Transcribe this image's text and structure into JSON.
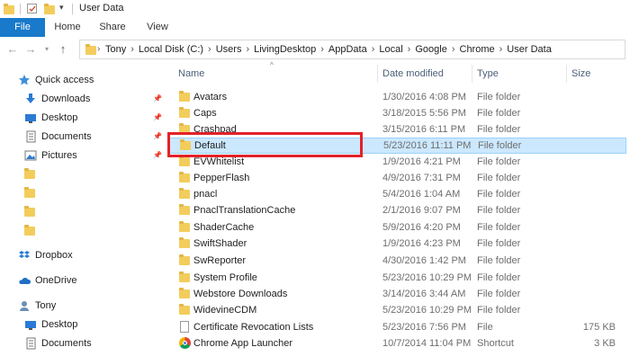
{
  "window": {
    "title": "User Data"
  },
  "ribbon": {
    "tabs": [
      {
        "label": "File"
      },
      {
        "label": "Home"
      },
      {
        "label": "Share"
      },
      {
        "label": "View"
      }
    ]
  },
  "address": {
    "crumbs": [
      "Tony",
      "Local Disk (C:)",
      "Users",
      "LivingDesktop",
      "AppData",
      "Local",
      "Google",
      "Chrome",
      "User Data"
    ]
  },
  "sidebar": {
    "items": [
      {
        "label": "Quick access",
        "icon": "star-icon"
      },
      {
        "label": "Downloads",
        "icon": "download-arrow-icon",
        "pinned": true
      },
      {
        "label": "Desktop",
        "icon": "desktop-icon",
        "pinned": true
      },
      {
        "label": "Documents",
        "icon": "documents-icon",
        "pinned": true
      },
      {
        "label": "Pictures",
        "icon": "pictures-icon",
        "pinned": true
      },
      {
        "label": "",
        "icon": "folder-icon"
      },
      {
        "label": "",
        "icon": "folder-icon"
      },
      {
        "label": "",
        "icon": "folder-icon"
      },
      {
        "label": "",
        "icon": "folder-icon"
      },
      {
        "label": "Dropbox",
        "icon": "dropbox-icon"
      },
      {
        "label": "OneDrive",
        "icon": "cloud-icon"
      },
      {
        "label": "Tony",
        "icon": "user-icon"
      },
      {
        "label": "Desktop",
        "icon": "desktop-icon"
      },
      {
        "label": "Documents",
        "icon": "documents-icon"
      }
    ]
  },
  "columns": {
    "name": "Name",
    "date": "Date modified",
    "type": "Type",
    "size": "Size"
  },
  "files": [
    {
      "name": "Avatars",
      "date": "1/30/2016 4:08 PM",
      "type": "File folder",
      "size": "",
      "kind": "folder"
    },
    {
      "name": "Caps",
      "date": "3/18/2015 5:56 PM",
      "type": "File folder",
      "size": "",
      "kind": "folder"
    },
    {
      "name": "Crashpad",
      "date": "3/15/2016 6:11 PM",
      "type": "File folder",
      "size": "",
      "kind": "folder"
    },
    {
      "name": "Default",
      "date": "5/23/2016 11:11 PM",
      "type": "File folder",
      "size": "",
      "kind": "folder",
      "selected": true
    },
    {
      "name": "EVWhitelist",
      "date": "1/9/2016 4:21 PM",
      "type": "File folder",
      "size": "",
      "kind": "folder"
    },
    {
      "name": "PepperFlash",
      "date": "4/9/2016 7:31 PM",
      "type": "File folder",
      "size": "",
      "kind": "folder"
    },
    {
      "name": "pnacl",
      "date": "5/4/2016 1:04 AM",
      "type": "File folder",
      "size": "",
      "kind": "folder"
    },
    {
      "name": "PnaclTranslationCache",
      "date": "2/1/2016 9:07 PM",
      "type": "File folder",
      "size": "",
      "kind": "folder"
    },
    {
      "name": "ShaderCache",
      "date": "5/9/2016 4:20 PM",
      "type": "File folder",
      "size": "",
      "kind": "folder"
    },
    {
      "name": "SwiftShader",
      "date": "1/9/2016 4:23 PM",
      "type": "File folder",
      "size": "",
      "kind": "folder"
    },
    {
      "name": "SwReporter",
      "date": "4/30/2016 1:42 PM",
      "type": "File folder",
      "size": "",
      "kind": "folder"
    },
    {
      "name": "System Profile",
      "date": "5/23/2016 10:29 PM",
      "type": "File folder",
      "size": "",
      "kind": "folder"
    },
    {
      "name": "Webstore Downloads",
      "date": "3/14/2016 3:44 AM",
      "type": "File folder",
      "size": "",
      "kind": "folder"
    },
    {
      "name": "WidevineCDM",
      "date": "5/23/2016 10:29 PM",
      "type": "File folder",
      "size": "",
      "kind": "folder"
    },
    {
      "name": "Certificate Revocation Lists",
      "date": "5/23/2016 7:56 PM",
      "type": "File",
      "size": "175 KB",
      "kind": "file"
    },
    {
      "name": "Chrome App Launcher",
      "date": "10/7/2014 11:04 PM",
      "type": "Shortcut",
      "size": "3 KB",
      "kind": "shortcut"
    }
  ],
  "colors": {
    "accent": "#1979ca",
    "selection": "#cce8ff",
    "highlight_box": "#e32129",
    "folder": "#f3cd5c"
  }
}
